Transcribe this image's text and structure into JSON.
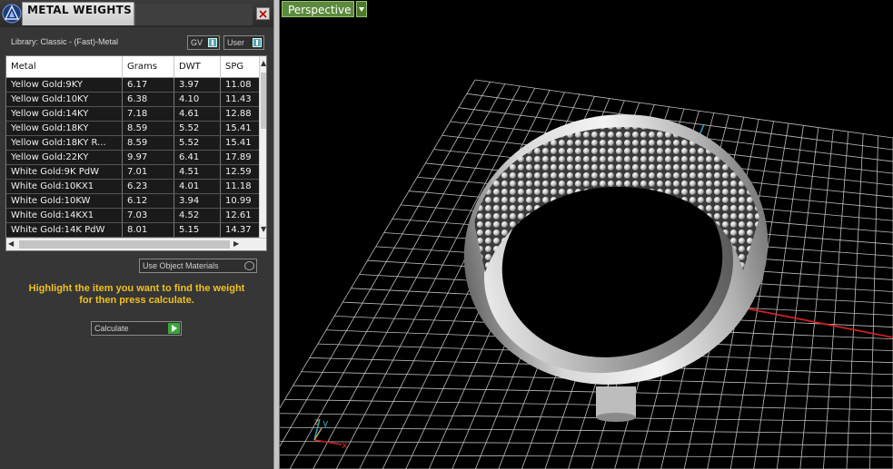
{
  "panel": {
    "title": "METAL WEIGHTS",
    "library_label": "Library: Classic - (Fast)-Metal",
    "toggle_gv": "GV",
    "toggle_user": "User",
    "use_object_materials": "Use Object Materials",
    "instructions_line1": "Highlight the item you want to find the weight",
    "instructions_line2": "for then press calculate.",
    "calculate_label": "Calculate"
  },
  "table": {
    "columns": [
      "Metal",
      "Grams",
      "DWT",
      "SPG"
    ],
    "rows": [
      [
        "Yellow Gold:9KY",
        "6.17",
        "3.97",
        "11.08"
      ],
      [
        "Yellow Gold:10KY",
        "6.38",
        "4.10",
        "11.43"
      ],
      [
        "Yellow Gold:14KY",
        "7.18",
        "4.61",
        "12.88"
      ],
      [
        "Yellow Gold:18KY",
        "8.59",
        "5.52",
        "15.41"
      ],
      [
        "Yellow Gold:18KY R...",
        "8.59",
        "5.52",
        "15.41"
      ],
      [
        "Yellow Gold:22KY",
        "9.97",
        "6.41",
        "17.89"
      ],
      [
        "White Gold:9K PdW",
        "7.01",
        "4.51",
        "12.59"
      ],
      [
        "White Gold:10KX1",
        "6.23",
        "4.01",
        "11.18"
      ],
      [
        "White Gold:10KW",
        "6.12",
        "3.94",
        "10.99"
      ],
      [
        "White Gold:14KX1",
        "7.03",
        "4.52",
        "12.61"
      ],
      [
        "White Gold:14K PdW",
        "8.01",
        "5.15",
        "14.37"
      ]
    ]
  },
  "viewport": {
    "view_name": "Perspective",
    "axis_x": "x",
    "axis_y": "y",
    "axis_z": "z"
  },
  "colors": {
    "panel_bg": "#363636",
    "instructions": "#f0c020",
    "view_tab": "#5a8a3c",
    "x_axis": "#cc2222",
    "y_axis": "#2aa0c0",
    "grid": "#d0d0d0"
  },
  "icons": {
    "logo": "app-logo-icon",
    "close": "close-icon",
    "calculate": "play-icon",
    "view_menu": "chevron-down-icon"
  }
}
